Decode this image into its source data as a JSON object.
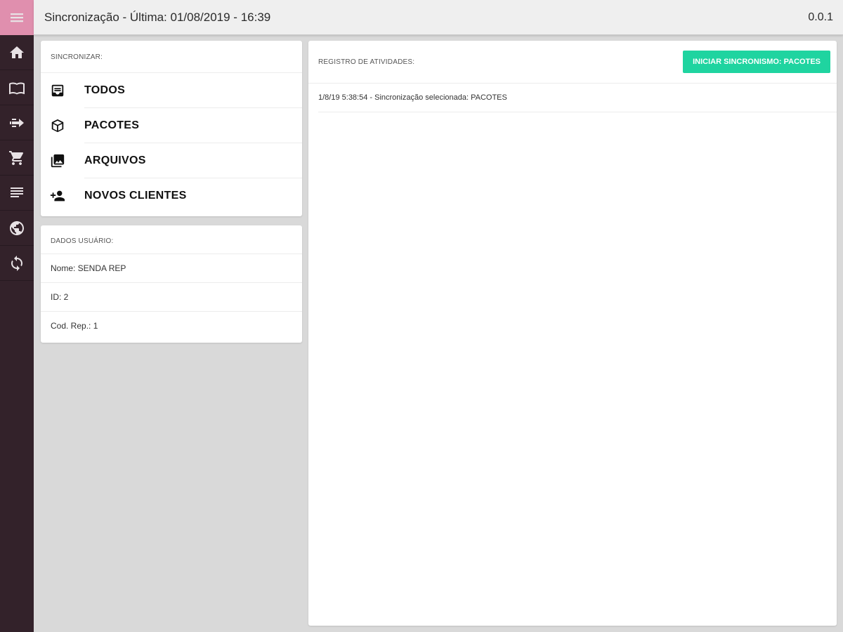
{
  "header": {
    "title": "Sincronização - Última: 01/08/2019 - 16:39",
    "version": "0.0.1"
  },
  "rail": {
    "items": [
      {
        "icon": "home-icon"
      },
      {
        "icon": "book-icon"
      },
      {
        "icon": "fast-arrow-icon"
      },
      {
        "icon": "cart-icon"
      },
      {
        "icon": "list-icon"
      },
      {
        "icon": "globe-icon"
      },
      {
        "icon": "sync-icon"
      }
    ],
    "accent": "#e08fae",
    "background": "#33222a"
  },
  "sync": {
    "label": "SINCRONIZAR:",
    "items": [
      {
        "label": "TODOS",
        "icon": "inbox-icon"
      },
      {
        "label": "PACOTES",
        "icon": "package-icon"
      },
      {
        "label": "ARQUIVOS",
        "icon": "images-icon"
      },
      {
        "label": "NOVOS CLIENTES",
        "icon": "add-person-icon"
      }
    ]
  },
  "user": {
    "label": "DADOS USUÁRIO:",
    "rows": [
      "Nome: SENDA REP",
      "ID: 2",
      "Cod. Rep.: 1"
    ]
  },
  "log": {
    "label": "REGISTRO DE ATIVIDADES:",
    "button_label": "INICIAR SINCRONISMO: PACOTES",
    "button_color": "#1fd4a0",
    "entries": [
      "1/8/19 5:38:54 - Sincronização selecionada: PACOTES"
    ]
  }
}
